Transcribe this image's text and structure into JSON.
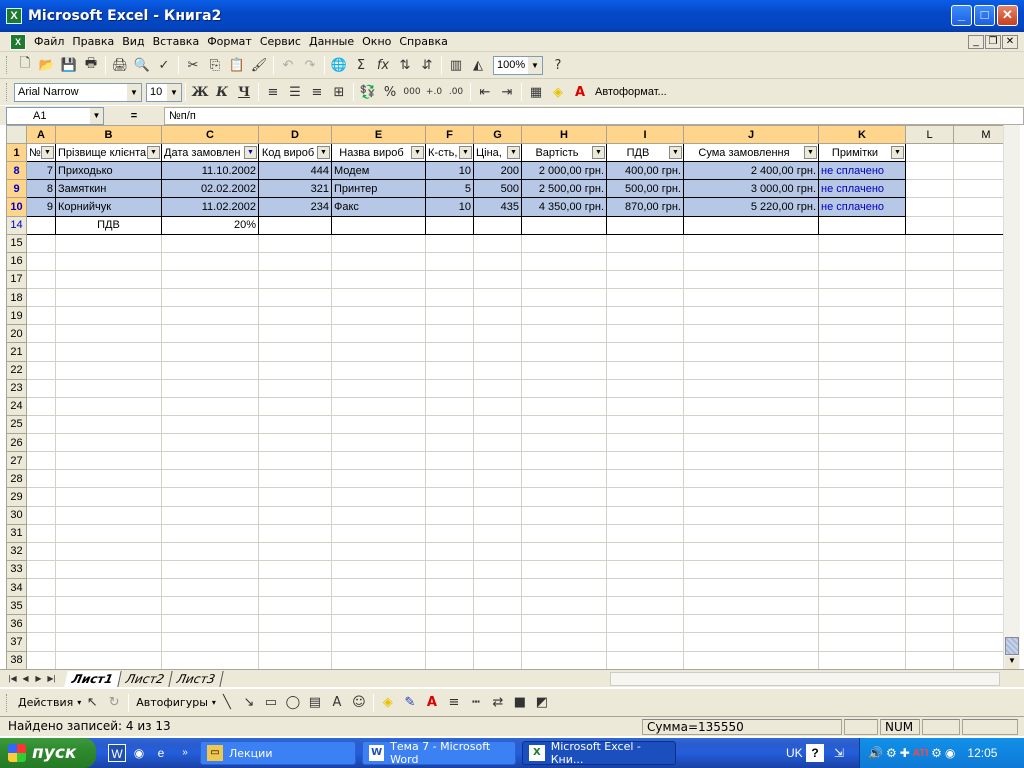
{
  "window": {
    "title": "Microsoft Excel - Книга2",
    "app_icon": "excel-icon"
  },
  "menu": [
    "Файл",
    "Правка",
    "Вид",
    "Вставка",
    "Формат",
    "Сервис",
    "Данные",
    "Окно",
    "Справка"
  ],
  "toolbar": {
    "zoom": "100%",
    "font": "Arial Narrow",
    "size": "10",
    "bold": "Ж",
    "italic": "К",
    "underline": "Ч",
    "autoformat": "Автоформат..."
  },
  "formula_bar": {
    "name_box": "A1",
    "fx": "=",
    "value": "№п/п"
  },
  "columns": [
    "A",
    "B",
    "C",
    "D",
    "E",
    "F",
    "G",
    "H",
    "I",
    "J",
    "K",
    "L",
    "M"
  ],
  "headers": [
    "№",
    "Прізвище клієнта",
    "Дата замовлен",
    "Код вироб",
    "Назва вироб",
    "К-сть,",
    "Ціна,",
    "Вартість",
    "ПДВ",
    "Сума замовлення",
    "Примітки"
  ],
  "rows": [
    {
      "n": "8",
      "cells": [
        "7",
        "Приходько",
        "11.10.2002",
        "444",
        "Модем",
        "10",
        "200",
        "2 000,00 грн.",
        "400,00 грн.",
        "2 400,00 грн.",
        "не сплачено"
      ]
    },
    {
      "n": "9",
      "cells": [
        "8",
        "Замяткин",
        "02.02.2002",
        "321",
        "Принтер",
        "5",
        "500",
        "2 500,00 грн.",
        "500,00 грн.",
        "3 000,00 грн.",
        "не сплачено"
      ]
    },
    {
      "n": "10",
      "cells": [
        "9",
        "Корнийчук",
        "11.02.2002",
        "234",
        "Факс",
        "10",
        "435",
        "4 350,00 грн.",
        "870,00 грн.",
        "5 220,00 грн.",
        "не сплачено"
      ]
    }
  ],
  "pdv_row": {
    "n": "14",
    "label": "ПДВ",
    "value": "20%"
  },
  "empty_rows": [
    "15",
    "16",
    "17",
    "18",
    "19",
    "20",
    "21",
    "22",
    "23",
    "24",
    "25",
    "26",
    "27",
    "28",
    "29",
    "30",
    "31",
    "32",
    "33",
    "34",
    "35",
    "36",
    "37",
    "38"
  ],
  "sheets": [
    "Лист1",
    "Лист2",
    "Лист3"
  ],
  "drawing": {
    "actions": "Действия",
    "autoshapes": "Автофигуры"
  },
  "status": {
    "message": "Найдено записей: 4 из 13",
    "sum": "Сумма=135550",
    "num": "NUM"
  },
  "taskbar": {
    "start": "пуск",
    "tasks": [
      "Лекции",
      "Тема 7 - Microsoft Word",
      "Microsoft Excel - Кни..."
    ],
    "lang": "UK",
    "clock": "12:05"
  },
  "colors": {
    "title_blue": "#0548c8",
    "band": "#b7c8e6",
    "selected_header": "#ffd58c",
    "note_blue": "#0000c0"
  }
}
